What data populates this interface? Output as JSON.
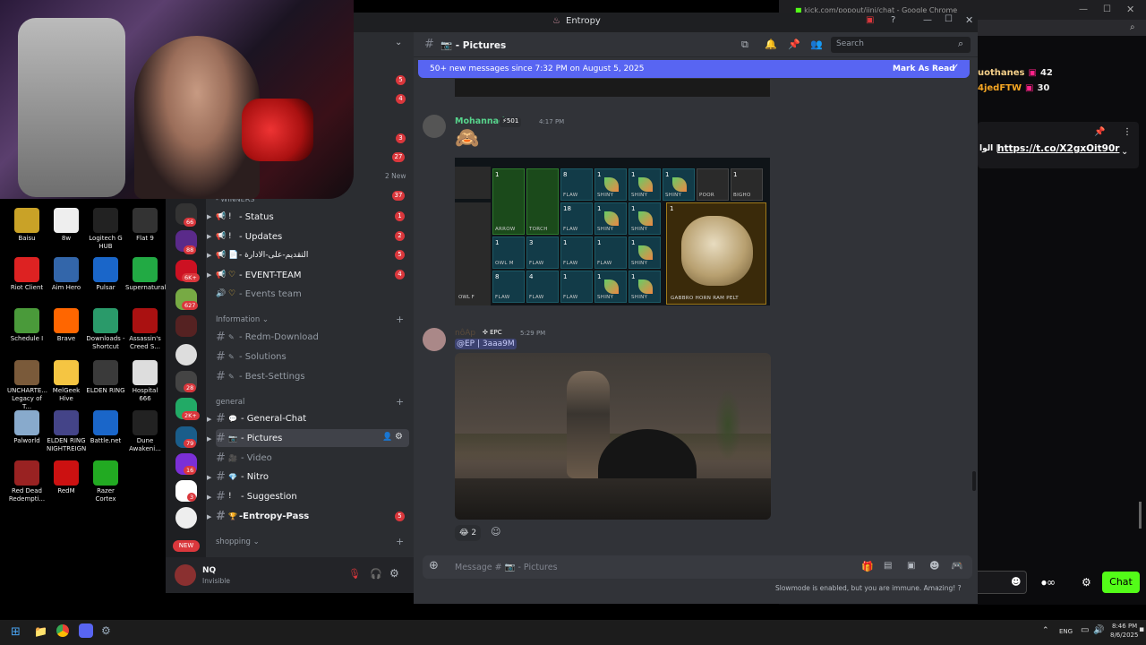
{
  "chrome": {
    "url_text": "kick.com/popout/jinj/chat - Google Chrome",
    "chat_users": [
      {
        "name": "uothanes",
        "count": "42"
      },
      {
        "name": "4jedFTW",
        "count": "30"
      }
    ],
    "pinned_prefix": "الوا |",
    "pinned_link": "https://t.co/X2gxOit90r",
    "slowmode": "Slowmode is enabled, but you are immune. Amazing!",
    "chat_button": "Chat"
  },
  "discord": {
    "window_title": "Entropy",
    "channel_title": "📷 - Pictures",
    "search_placeholder": "Search",
    "new_messages_banner": "50+ new messages since 7:32 PM on August 5, 2025",
    "mark_as_read": "Mark As Read",
    "message_placeholder": "Message # 📷 - Pictures",
    "unread_badges": [
      "5",
      "4",
      "3",
      "27",
      "2 New",
      "37"
    ],
    "channels": [
      {
        "icon": "!",
        "name": "- Status",
        "badge": "1"
      },
      {
        "icon": "!",
        "name": "- Updates",
        "badge": "2"
      },
      {
        "icon": "📄",
        "name": "- التقديم-على-الادارة",
        "badge": "5"
      },
      {
        "icon": "♡",
        "name": "- EVENT-TEAM",
        "badge": "4"
      },
      {
        "icon": "♡",
        "name": "- Events team",
        "badge": ""
      }
    ],
    "category_information": "Information",
    "info_channels": [
      "- Redm-Download",
      "- Solutions",
      "- Best-Settings"
    ],
    "category_general": "general",
    "general_channels": [
      {
        "icon": "💬",
        "name": "- General-Chat",
        "badge": ""
      },
      {
        "icon": "📷",
        "name": "- Pictures",
        "badge": ""
      },
      {
        "icon": "🎥",
        "name": "- Video",
        "badge": ""
      },
      {
        "icon": "💎",
        "name": "- Nitro",
        "badge": ""
      },
      {
        "icon": "!",
        "name": "- Suggestion",
        "badge": ""
      },
      {
        "icon": "🏆",
        "name": "-Entropy-Pass",
        "badge": "5"
      }
    ],
    "category_shopping": "shopping",
    "server_badges": [
      "66",
      "88",
      "6K+",
      "627",
      "28",
      "2K+",
      "79",
      "16",
      "3"
    ],
    "new_pill": "NEW",
    "user": {
      "name": "NQ",
      "status": "Invisible"
    },
    "messages": [
      {
        "author": "Mohannad",
        "tag": "501",
        "time": "4:17 PM",
        "emoji": "🙈"
      },
      {
        "author": "nôAp",
        "tag": "EPC",
        "time": "5:29 PM",
        "mention": "@EP | 3aaa9M",
        "reaction_count": "2"
      }
    ],
    "inventory_labels": {
      "arrow": "ARROW",
      "torch": "TORCH",
      "flaw": "FLAW",
      "shiny": "SHINY",
      "poor": "POOR",
      "bighorn": "BIGHO",
      "owl": "OWL F",
      "owl_m": "OWL M",
      "pelt": "GABBRO HORN RAM PELT"
    },
    "top_row_label": "OWL F..."
  },
  "desktop_icons": [
    {
      "label": "Baisu"
    },
    {
      "label": "8w"
    },
    {
      "label": "Logitech G HUB"
    },
    {
      "label": "Flat 9"
    },
    {
      "label": "Riot Client"
    },
    {
      "label": "Aim Hero"
    },
    {
      "label": "Pulsar"
    },
    {
      "label": "Supernatural"
    },
    {
      "label": "Schedule I"
    },
    {
      "label": "Brave"
    },
    {
      "label": "Downloads - Shortcut"
    },
    {
      "label": "Assassin's Creed S..."
    },
    {
      "label": "UNCHARTE... Legacy of T..."
    },
    {
      "label": "MelGeek Hive"
    },
    {
      "label": "ELDEN RING"
    },
    {
      "label": "Hospital 666"
    },
    {
      "label": "Palworld"
    },
    {
      "label": "ELDEN RING NIGHTREIGN"
    },
    {
      "label": "Battle.net"
    },
    {
      "label": "Dune Awakeni..."
    },
    {
      "label": "Red Dead Redempti..."
    },
    {
      "label": "RedM"
    },
    {
      "label": "Razer Cortex"
    }
  ],
  "taskbar": {
    "lang": "ENG",
    "time": "8:46 PM",
    "date": "8/6/2025"
  },
  "colors": {
    "discord_bg": "#313338",
    "sidebar": "#2b2d31",
    "banner": "#5865f2",
    "chat_green": "#53fc18"
  }
}
